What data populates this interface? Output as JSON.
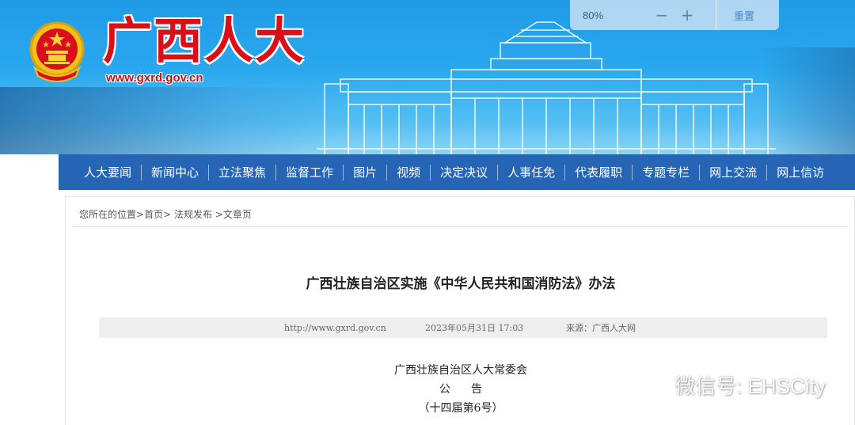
{
  "header": {
    "site_name": "广西人大",
    "site_url": "www.gxrd.gov.cn",
    "brand_color": "#d9101a"
  },
  "zoom": {
    "level": "80%",
    "zoom_out_label": "−",
    "zoom_in_label": "+",
    "reset_label": "重置"
  },
  "nav": {
    "items": [
      {
        "label": "人大要闻"
      },
      {
        "label": "新闻中心"
      },
      {
        "label": "立法聚焦"
      },
      {
        "label": "监督工作"
      },
      {
        "label": "图片"
      },
      {
        "label": "视频"
      },
      {
        "label": "决定决议"
      },
      {
        "label": "人事任免"
      },
      {
        "label": "代表履职"
      },
      {
        "label": "专题专栏"
      },
      {
        "label": "网上交流"
      },
      {
        "label": "网上信访"
      }
    ],
    "bg_color": "#2664b6"
  },
  "breadcrumb": {
    "prefix": "您所在的位置",
    "home": "首页",
    "section": "法规发布",
    "current": "文章页"
  },
  "article": {
    "title": "广西壮族自治区实施《中华人民共和国消防法》办法",
    "meta_url": "http://www.gxrd.gov.cn",
    "meta_time": "2023年05月31日 17:03",
    "meta_source": "来源：广西人大网",
    "issuer": "广西壮族自治区人大常委会",
    "notice": "公告",
    "issue_no": "（十四届第6号）"
  },
  "watermark": {
    "text": "微信号: EHSCity"
  }
}
